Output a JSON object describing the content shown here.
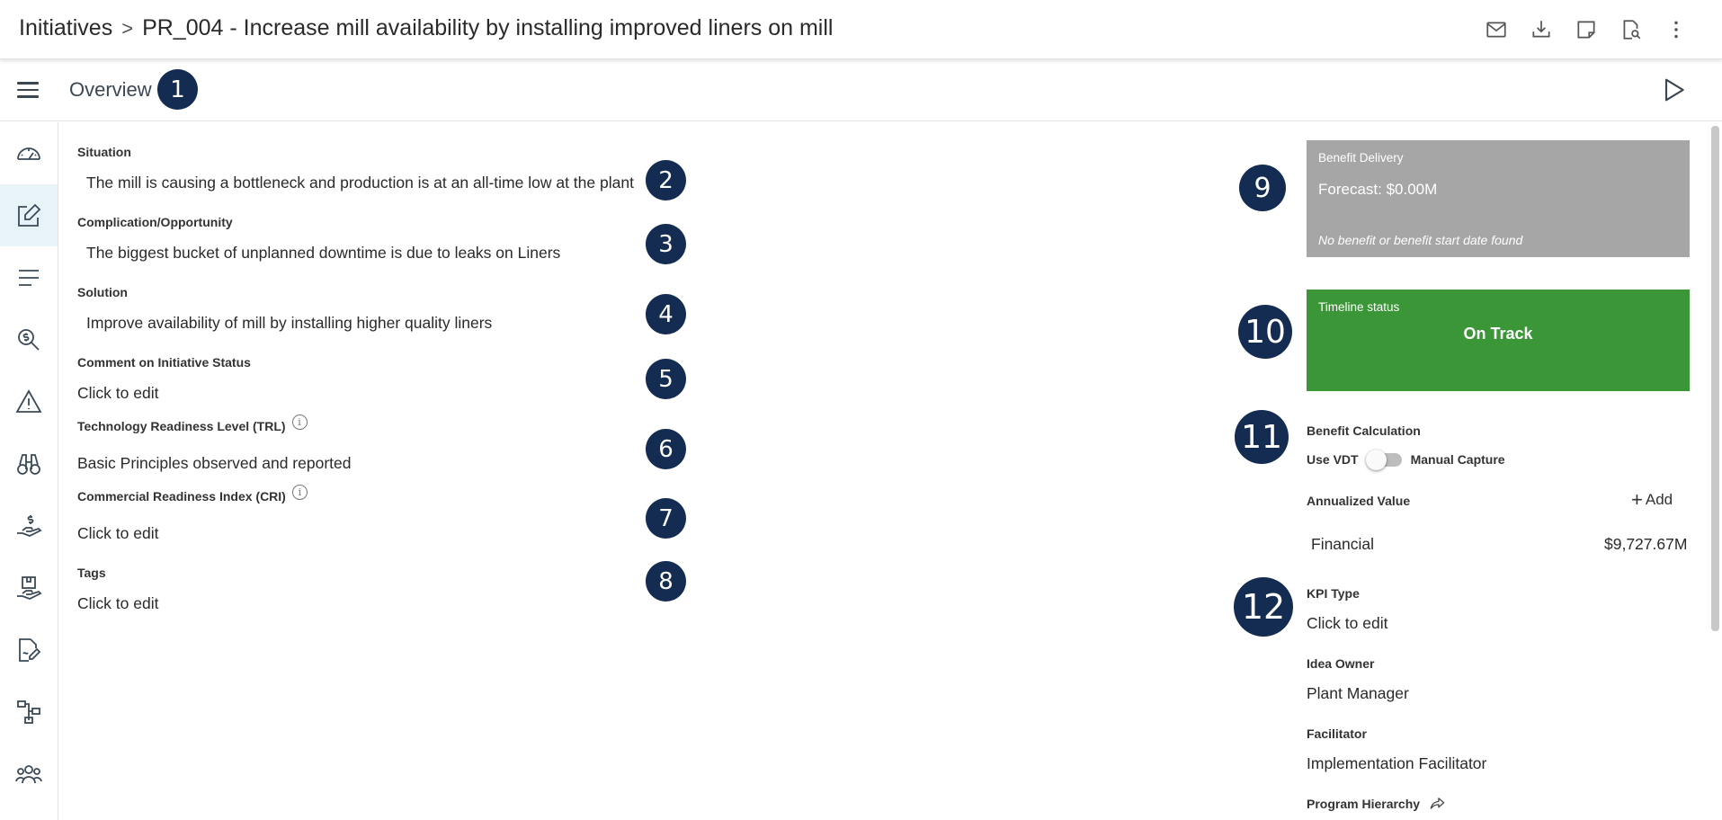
{
  "header": {
    "breadcrumb_root": "Initiatives",
    "breadcrumb_sep": ">",
    "breadcrumb_current": "PR_004 - Increase mill availability by installing improved liners on mill",
    "icons": [
      "mail-icon",
      "download-icon",
      "note-icon",
      "document-search-icon",
      "more-vert-icon"
    ]
  },
  "subheader": {
    "title": "Overview"
  },
  "sidenav": {
    "items": [
      "dashboard-icon",
      "edit-icon",
      "list-icon",
      "cost-search-icon",
      "warning-icon",
      "binoculars-icon",
      "hand-money-icon",
      "package-hand-icon",
      "document-sign-icon",
      "hierarchy-icon",
      "team-icon"
    ],
    "active_index": 1
  },
  "fields": {
    "situation": {
      "label": "Situation",
      "value": "The mill is causing a bottleneck and production is at an all-time low at the plant"
    },
    "complication": {
      "label": "Complication/Opportunity",
      "value": "The biggest bucket of unplanned downtime is due to leaks on Liners"
    },
    "solution": {
      "label": "Solution",
      "value": "Improve availability of mill by installing higher quality liners"
    },
    "comment": {
      "label": "Comment on Initiative Status",
      "value": "Click to edit"
    },
    "trl": {
      "label": "Technology Readiness Level (TRL)",
      "value": "Basic Principles observed and reported"
    },
    "cri": {
      "label": "Commercial Readiness Index (CRI)",
      "value": "Click to edit"
    },
    "tags": {
      "label": "Tags",
      "value": "Click to edit"
    }
  },
  "badges": [
    "1",
    "2",
    "3",
    "4",
    "5",
    "6",
    "7",
    "8",
    "9",
    "10",
    "11",
    "12"
  ],
  "right": {
    "benefit_delivery": {
      "title": "Benefit Delivery",
      "forecast": "Forecast: $0.00M",
      "note": "No benefit or benefit start date found",
      "color": "#a6a6a6"
    },
    "timeline": {
      "title": "Timeline status",
      "status": "On Track",
      "color": "#3a9637"
    },
    "benefit_calc": {
      "label": "Benefit Calculation",
      "left_option": "Use VDT",
      "right_option": "Manual Capture",
      "toggle_on": false
    },
    "annualized": {
      "label": "Annualized Value",
      "add_label": "Add",
      "row_label": "Financial",
      "row_value": "$9,727.67M"
    },
    "kpi_type": {
      "label": "KPI Type",
      "value": "Click to edit"
    },
    "idea_owner": {
      "label": "Idea Owner",
      "value": "Plant Manager"
    },
    "facilitator": {
      "label": "Facilitator",
      "value": "Implementation Facilitator"
    },
    "program_hierarchy": {
      "label": "Program Hierarchy"
    }
  },
  "colors": {
    "badge": "#142c52",
    "nav_active_bg": "#e8f3f8"
  }
}
